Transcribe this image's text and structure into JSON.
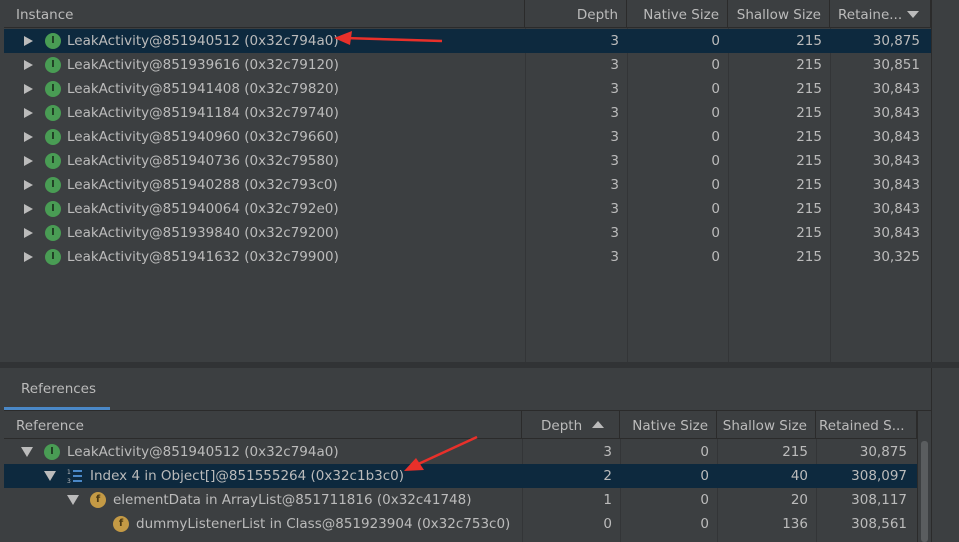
{
  "instances": {
    "columns": {
      "instance": "Instance",
      "depth": "Depth",
      "native": "Native Size",
      "shallow": "Shallow Size",
      "retained": "Retaine..."
    },
    "rows": [
      {
        "name": "LeakActivity@851940512 (0x32c794a0)",
        "depth": "3",
        "native": "0",
        "shallow": "215",
        "retained": "30,875"
      },
      {
        "name": "LeakActivity@851939616 (0x32c79120)",
        "depth": "3",
        "native": "0",
        "shallow": "215",
        "retained": "30,851"
      },
      {
        "name": "LeakActivity@851941408 (0x32c79820)",
        "depth": "3",
        "native": "0",
        "shallow": "215",
        "retained": "30,843"
      },
      {
        "name": "LeakActivity@851941184 (0x32c79740)",
        "depth": "3",
        "native": "0",
        "shallow": "215",
        "retained": "30,843"
      },
      {
        "name": "LeakActivity@851940960 (0x32c79660)",
        "depth": "3",
        "native": "0",
        "shallow": "215",
        "retained": "30,843"
      },
      {
        "name": "LeakActivity@851940736 (0x32c79580)",
        "depth": "3",
        "native": "0",
        "shallow": "215",
        "retained": "30,843"
      },
      {
        "name": "LeakActivity@851940288 (0x32c793c0)",
        "depth": "3",
        "native": "0",
        "shallow": "215",
        "retained": "30,843"
      },
      {
        "name": "LeakActivity@851940064 (0x32c792e0)",
        "depth": "3",
        "native": "0",
        "shallow": "215",
        "retained": "30,843"
      },
      {
        "name": "LeakActivity@851939840 (0x32c79200)",
        "depth": "3",
        "native": "0",
        "shallow": "215",
        "retained": "30,843"
      },
      {
        "name": "LeakActivity@851941632 (0x32c79900)",
        "depth": "3",
        "native": "0",
        "shallow": "215",
        "retained": "30,325"
      }
    ]
  },
  "references": {
    "tab_label": "References",
    "columns": {
      "reference": "Reference",
      "depth": "Depth",
      "native": "Native Size",
      "shallow": "Shallow Size",
      "retained": "Retained S..."
    },
    "rows": [
      {
        "name": "LeakActivity@851940512 (0x32c794a0)",
        "depth": "3",
        "native": "0",
        "shallow": "215",
        "retained": "30,875"
      },
      {
        "name": "Index 4 in Object[]@851555264 (0x32c1b3c0)",
        "depth": "2",
        "native": "0",
        "shallow": "40",
        "retained": "308,097"
      },
      {
        "name": "elementData in ArrayList@851711816 (0x32c41748)",
        "depth": "1",
        "native": "0",
        "shallow": "20",
        "retained": "308,117"
      },
      {
        "name": "dummyListenerList in Class@851923904 (0x32c753c0)",
        "depth": "0",
        "native": "0",
        "shallow": "136",
        "retained": "308,561"
      }
    ]
  },
  "badges": {
    "instance": "I",
    "field": "f"
  },
  "icons": {
    "instance": "instance-class-icon",
    "array": "array-index-icon",
    "field": "field-icon",
    "expand": "expand-arrow-icon",
    "collapse": "collapse-arrow-icon",
    "sort_desc": "sort-descending-icon",
    "sort_asc": "sort-ascending-icon"
  },
  "colors": {
    "background": "#3c3f41",
    "selection": "#0d293e",
    "instance_badge": "#499c54",
    "field_badge": "#c49a45",
    "annotation_arrow": "#e8302a",
    "tab_underline": "#4a88c7"
  }
}
